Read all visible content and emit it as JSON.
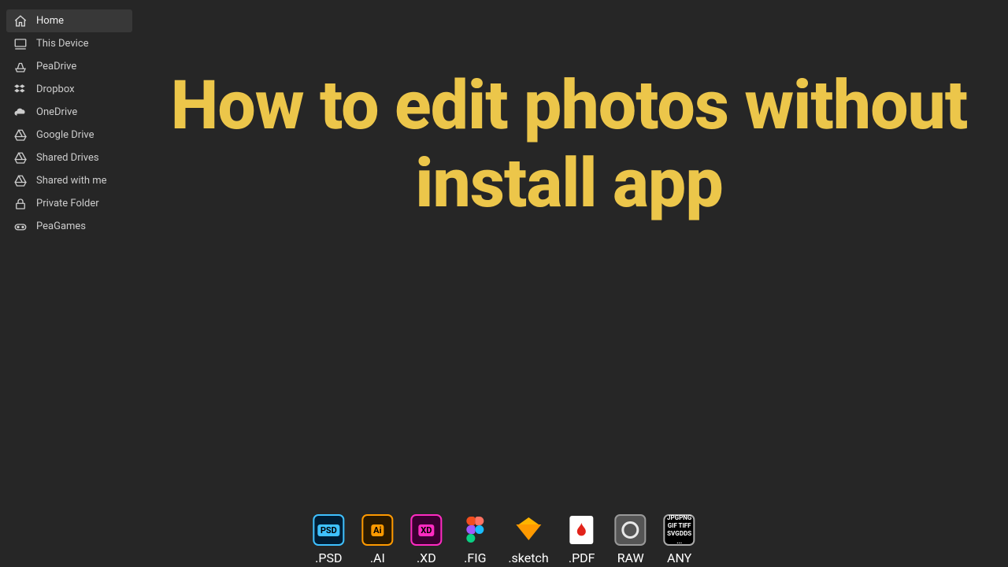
{
  "sidebar": {
    "items": [
      {
        "label": "Home",
        "active": true
      },
      {
        "label": "This Device",
        "active": false
      },
      {
        "label": "PeaDrive",
        "active": false
      },
      {
        "label": "Dropbox",
        "active": false
      },
      {
        "label": "OneDrive",
        "active": false
      },
      {
        "label": "Google Drive",
        "active": false
      },
      {
        "label": "Shared Drives",
        "active": false
      },
      {
        "label": "Shared with me",
        "active": false
      },
      {
        "label": "Private Folder",
        "active": false
      },
      {
        "label": "PeaGames",
        "active": false
      }
    ]
  },
  "headline": "How to edit photos without install app",
  "formats": [
    {
      "label": ".PSD"
    },
    {
      "label": ".AI"
    },
    {
      "label": ".XD"
    },
    {
      "label": ".FIG"
    },
    {
      "label": ".sketch"
    },
    {
      "label": ".PDF"
    },
    {
      "label": "RAW"
    },
    {
      "label": "ANY"
    }
  ],
  "anyGrid": [
    "JPG",
    "PNG",
    "GIF",
    "TIFF",
    "SVG",
    "DDS",
    "..."
  ]
}
